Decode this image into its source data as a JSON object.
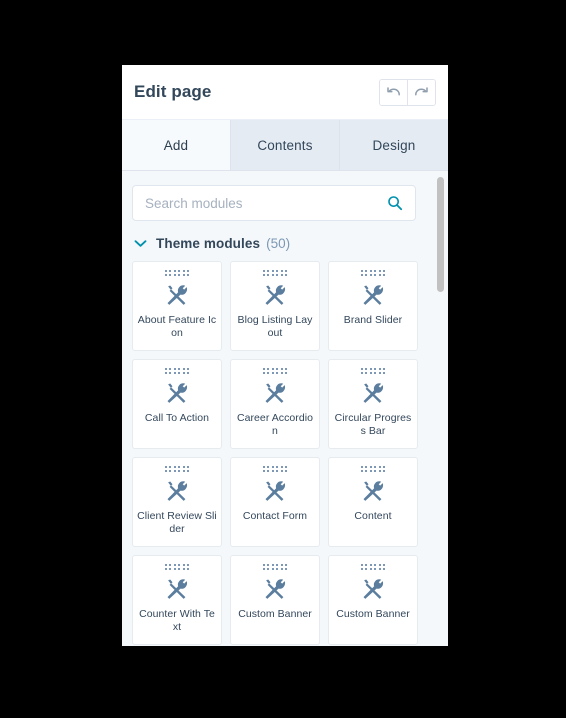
{
  "header": {
    "title": "Edit page",
    "undo_label": "Undo",
    "redo_label": "Redo"
  },
  "tabs": [
    {
      "label": "Add",
      "active": true
    },
    {
      "label": "Contents",
      "active": false
    },
    {
      "label": "Design",
      "active": false
    }
  ],
  "search": {
    "placeholder": "Search modules",
    "value": "",
    "icon": "search-icon"
  },
  "section": {
    "title": "Theme modules",
    "count": "(50)",
    "expanded": true,
    "chevron_icon": "chevron-down-icon"
  },
  "modules": [
    {
      "label": "About Feature Icon"
    },
    {
      "label": "Blog Listing Layout"
    },
    {
      "label": "Brand Slider"
    },
    {
      "label": "Call To Action"
    },
    {
      "label": "Career Accordion"
    },
    {
      "label": "Circular Progress Bar"
    },
    {
      "label": "Client Review Slider"
    },
    {
      "label": "Contact Form"
    },
    {
      "label": "Content"
    },
    {
      "label": "Counter With Text"
    },
    {
      "label": "Custom Banner"
    },
    {
      "label": "Custom Banner"
    }
  ],
  "colors": {
    "accent_teal": "#0091ae",
    "panel_bg": "#f5f8fa",
    "tab_active_bg": "#f7fafc",
    "tab_inactive_bg": "#e5ebf2",
    "text_dark": "#33475b",
    "module_icon": "#5b7d9e",
    "scrollbar_thumb": "#c1c1c1",
    "page_bg": "#000000"
  }
}
